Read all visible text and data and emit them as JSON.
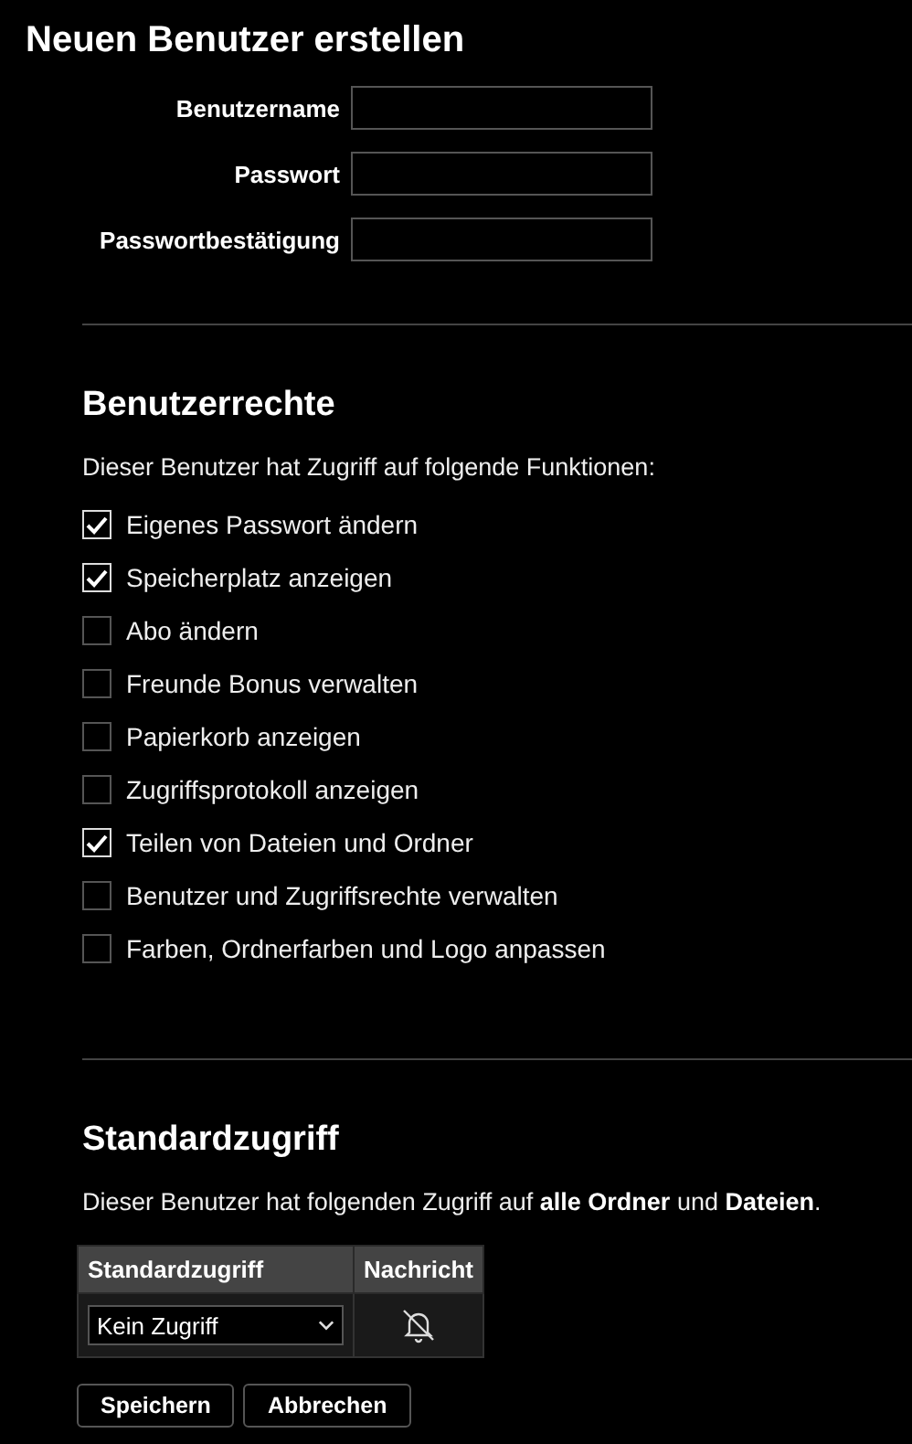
{
  "title": "Neuen Benutzer erstellen",
  "fields": [
    {
      "label": "Benutzername"
    },
    {
      "label": "Passwort"
    },
    {
      "label": "Passwortbestätigung"
    }
  ],
  "rights": {
    "heading": "Benutzerrechte",
    "description": "Dieser Benutzer hat Zugriff auf folgende Funktionen:",
    "items": [
      {
        "label": "Eigenes Passwort ändern",
        "checked": true
      },
      {
        "label": "Speicherplatz anzeigen",
        "checked": true
      },
      {
        "label": "Abo ändern",
        "checked": false
      },
      {
        "label": "Freunde Bonus verwalten",
        "checked": false
      },
      {
        "label": "Papierkorb anzeigen",
        "checked": false
      },
      {
        "label": "Zugriffsprotokoll anzeigen",
        "checked": false
      },
      {
        "label": "Teilen von Dateien und Ordner",
        "checked": true
      },
      {
        "label": "Benutzer und Zugriffsrechte verwalten",
        "checked": false
      },
      {
        "label": "Farben, Ordnerfarben und Logo anpassen",
        "checked": false
      }
    ]
  },
  "default_access": {
    "heading": "Standardzugriff",
    "description": "Dieser Benutzer hat folgenden Zugriff auf **alle Ordner** und **Dateien**.",
    "table": {
      "columns": [
        "Standardzugriff",
        "Nachricht"
      ],
      "access": "Kein Zugriff",
      "notification": false
    }
  },
  "buttons": [
    "Speichern",
    "Abbrechen"
  ]
}
